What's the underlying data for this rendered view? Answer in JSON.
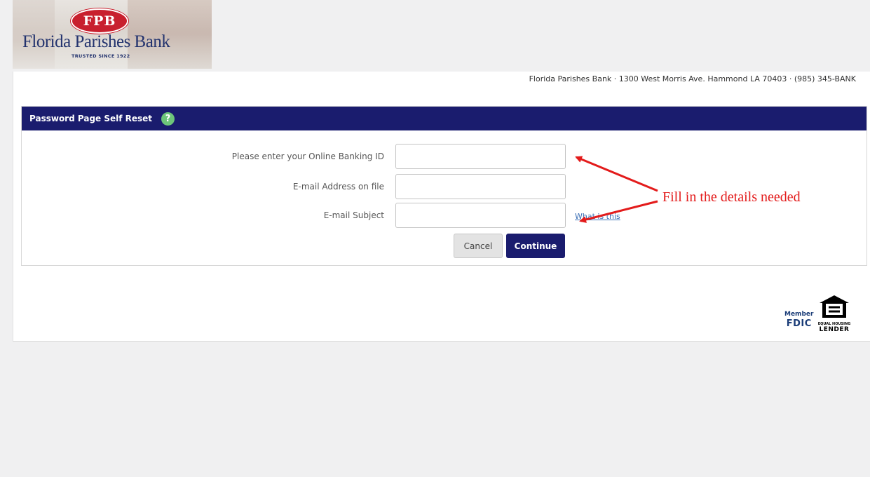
{
  "logo": {
    "initials": "FPB",
    "name": "Florida Parishes Bank",
    "tagline": "TRUSTED SINCE 1922"
  },
  "header": {
    "address": "Florida Parishes Bank · 1300 West Morris Ave. Hammond LA 70403 · (985) 345-BANK"
  },
  "form": {
    "title": "Password Page Self Reset",
    "help_icon": "?",
    "fields": [
      {
        "label": "Please enter your Online Banking ID",
        "value": "",
        "placeholder": ""
      },
      {
        "label": "E-mail Address on file",
        "value": "",
        "placeholder": ""
      },
      {
        "label": "E-mail Subject",
        "value": "",
        "placeholder": ""
      }
    ],
    "what_is_this": "What is this",
    "cancel_label": "Cancel",
    "continue_label": "Continue"
  },
  "footer": {
    "fdic_member": "Member",
    "fdic": "FDIC",
    "ehl_line1": "EQUAL HOUSING",
    "ehl_line2": "LENDER"
  },
  "annotation": {
    "text": "Fill in the details needed",
    "color": "#e31b1b"
  },
  "colors": {
    "header_bar": "#1a1c6e",
    "brand_red": "#c8202e",
    "brand_blue": "#23336e",
    "help_green": "#6dc57a"
  }
}
